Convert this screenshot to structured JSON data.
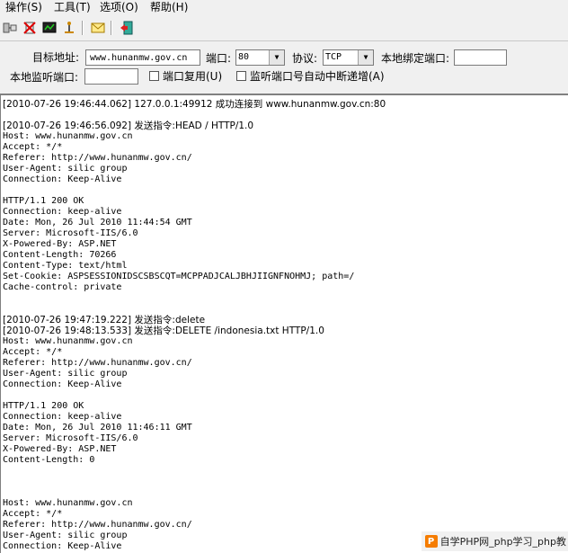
{
  "menu": [
    "操作(S)",
    "工具(T)",
    "选项(O)",
    "帮助(H)"
  ],
  "toolbar": {
    "icons": [
      "connect-icon",
      "disconnect-icon",
      "monitor-icon",
      "anchor-icon",
      "mail-icon",
      "exit-icon"
    ]
  },
  "form": {
    "target_label": "目标地址:",
    "target_value": "www.hunanmw.gov.cn",
    "port_label": "端口:",
    "port_value": "80",
    "protocol_label": "协议:",
    "protocol_value": "TCP",
    "local_bind_label": "本地绑定端口:",
    "local_bind_value": "",
    "local_listen_label": "本地监听端口:",
    "local_listen_value": "",
    "port_reuse_label": "端口复用(U)",
    "auto_increase_label": "监听端口号自动中断递增(A)"
  },
  "log_lines": [
    "[2010-07-26 19:46:44.062] 127.0.0.1:49912 成功连接到 www.hunanmw.gov.cn:80",
    "",
    "[2010-07-26 19:46:56.092] 发送指令:HEAD / HTTP/1.0",
    "Host: www.hunanmw.gov.cn",
    "Accept: */*",
    "Referer: http://www.hunanmw.gov.cn/",
    "User-Agent: silic group",
    "Connection: Keep-Alive",
    "",
    "HTTP/1.1 200 OK",
    "Connection: keep-alive",
    "Date: Mon, 26 Jul 2010 11:44:54 GMT",
    "Server: Microsoft-IIS/6.0",
    "X-Powered-By: ASP.NET",
    "Content-Length: 70266",
    "Content-Type: text/html",
    "Set-Cookie: ASPSESSIONIDSCSBSCQT=MCPPADJCALJBHJIIGNFNOHMJ; path=/",
    "Cache-control: private",
    "",
    "",
    "[2010-07-26 19:47:19.222] 发送指令:delete",
    "[2010-07-26 19:48:13.533] 发送指令:DELETE /indonesia.txt HTTP/1.0",
    "Host: www.hunanmw.gov.cn",
    "Accept: */*",
    "Referer: http://www.hunanmw.gov.cn/",
    "User-Agent: silic group",
    "Connection: Keep-Alive",
    "",
    "HTTP/1.1 200 OK",
    "Connection: keep-alive",
    "Date: Mon, 26 Jul 2010 11:46:11 GMT",
    "Server: Microsoft-IIS/6.0",
    "X-Powered-By: ASP.NET",
    "Content-Length: 0",
    "",
    "",
    "",
    "Host: www.hunanmw.gov.cn",
    "Accept: */*",
    "Referer: http://www.hunanmw.gov.cn/",
    "User-Agent: silic group",
    "Connection: Keep-Alive"
  ],
  "watermark": "自学PHP网_php学习_php教"
}
